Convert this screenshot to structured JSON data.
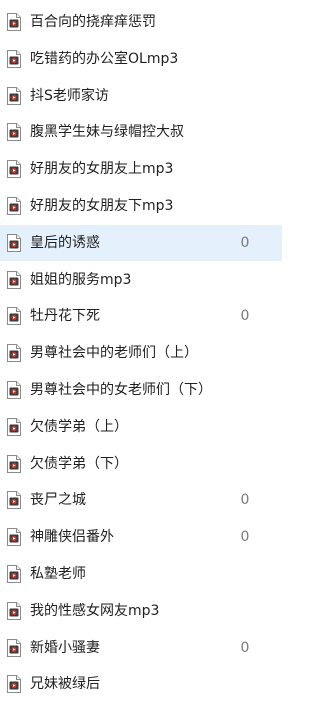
{
  "files": [
    {
      "name": "百合向的挠痒痒惩罚",
      "count": "",
      "selected": false,
      "icon": "media-file-icon"
    },
    {
      "name": "吃错药的办公室OLmp3",
      "count": "",
      "selected": false,
      "icon": "media-file-icon"
    },
    {
      "name": "抖S老师家访",
      "count": "",
      "selected": false,
      "icon": "media-file-icon"
    },
    {
      "name": "腹黑学生妹与绿帽控大叔",
      "count": "",
      "selected": false,
      "icon": "media-file-icon"
    },
    {
      "name": "好朋友的女朋友上mp3",
      "count": "",
      "selected": false,
      "icon": "media-file-icon"
    },
    {
      "name": "好朋友的女朋友下mp3",
      "count": "",
      "selected": false,
      "icon": "media-file-icon"
    },
    {
      "name": "皇后的诱惑",
      "count": "0",
      "selected": true,
      "icon": "media-file-icon"
    },
    {
      "name": "姐姐的服务mp3",
      "count": "",
      "selected": false,
      "icon": "media-file-icon"
    },
    {
      "name": "牡丹花下死",
      "count": "0",
      "selected": false,
      "icon": "media-file-icon"
    },
    {
      "name": "男尊社会中的老师们（上）",
      "count": "",
      "selected": false,
      "icon": "media-file-icon"
    },
    {
      "name": "男尊社会中的女老师们（下）",
      "count": "",
      "selected": false,
      "icon": "media-file-icon"
    },
    {
      "name": "欠债学弟（上）",
      "count": "",
      "selected": false,
      "icon": "media-file-icon"
    },
    {
      "name": "欠债学弟（下）",
      "count": "",
      "selected": false,
      "icon": "media-file-icon"
    },
    {
      "name": "丧尸之城",
      "count": "0",
      "selected": false,
      "icon": "media-file-icon"
    },
    {
      "name": "神雕侠侣番外",
      "count": "0",
      "selected": false,
      "icon": "media-file-icon"
    },
    {
      "name": "私塾老师",
      "count": "",
      "selected": false,
      "icon": "media-file-icon"
    },
    {
      "name": "我的性感女网友mp3",
      "count": "",
      "selected": false,
      "icon": "media-file-icon"
    },
    {
      "name": "新婚小骚妻",
      "count": "0",
      "selected": false,
      "icon": "media-file-icon"
    },
    {
      "name": "兄妹被绿后",
      "count": "",
      "selected": false,
      "icon": "media-file-icon"
    }
  ],
  "colors": {
    "selected_background": "#e4f0fb",
    "icon_frame": "#8a8a8a",
    "icon_accent": "#c0392b",
    "count_text": "#7a7a7a"
  }
}
